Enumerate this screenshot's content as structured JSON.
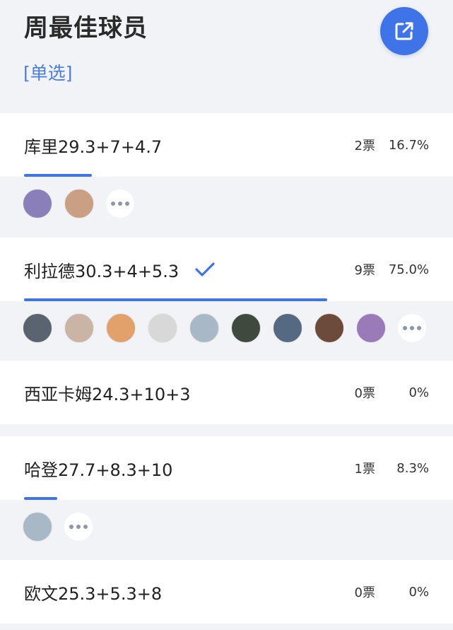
{
  "poll": {
    "title": "周最佳球员",
    "type_label": "[单选]",
    "share_icon": "share-external-icon",
    "accent_color": "#3f73e8"
  },
  "options": [
    {
      "label": "库里29.3+7+4.7",
      "votes": "2票",
      "percent": "16.7%",
      "fraction": 0.167,
      "selected": false,
      "voters": [
        "#8a7fb8",
        "#c9a083"
      ]
    },
    {
      "label": "利拉德30.3+4+5.3",
      "votes": "9票",
      "percent": "75.0%",
      "fraction": 0.75,
      "selected": true,
      "voters": [
        "#5a6470",
        "#c9b4a6",
        "#e2a06a",
        "#d8d8d8",
        "#a9b8c6",
        "#3d4a3d",
        "#556a82",
        "#6c4b3a",
        "#9a7ab8"
      ]
    },
    {
      "label": "西亚卡姆24.3+10+3",
      "votes": "0票",
      "percent": "0%",
      "fraction": 0,
      "selected": false,
      "voters": []
    },
    {
      "label": "哈登27.7+8.3+10",
      "votes": "1票",
      "percent": "8.3%",
      "fraction": 0.083,
      "selected": false,
      "voters": [
        "#a9b8c6"
      ]
    },
    {
      "label": "欧文25.3+5.3+8",
      "votes": "0票",
      "percent": "0%",
      "fraction": 0,
      "selected": false,
      "voters": []
    }
  ]
}
